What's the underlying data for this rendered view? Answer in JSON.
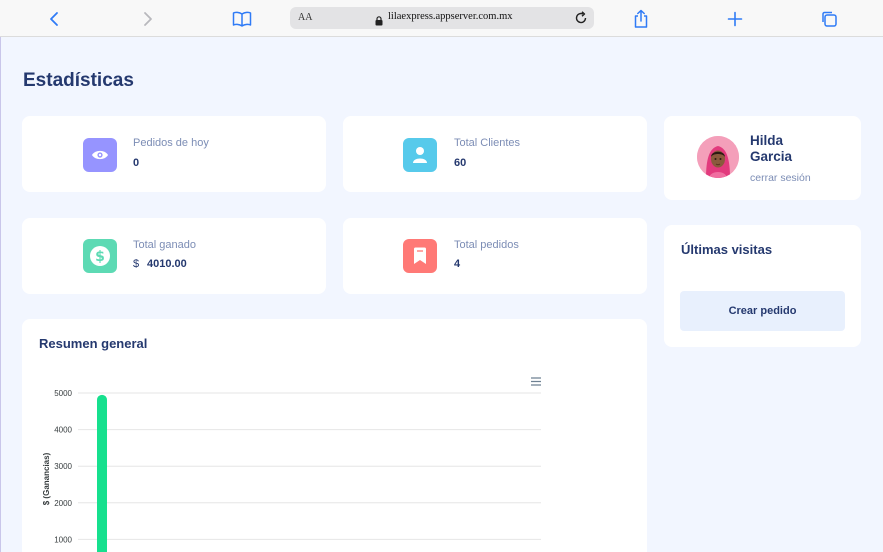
{
  "browser": {
    "text_size_label": "AA",
    "url": "lilaexpress.appserver.com.mx"
  },
  "page": {
    "title": "Estadísticas"
  },
  "stats": {
    "pedidos_hoy": {
      "label": "Pedidos de hoy",
      "value": "0",
      "color": "#9694ff"
    },
    "total_clientes": {
      "label": "Total Clientes",
      "value": "60",
      "color": "#57caeb"
    },
    "total_ganado": {
      "label": "Total ganado",
      "currency": "$",
      "value": "4010.00",
      "color": "#5ddab4"
    },
    "total_pedidos": {
      "label": "Total pedidos",
      "value": "4",
      "color": "#ff7976"
    }
  },
  "profile": {
    "name": "Hilda Garcia",
    "logout": "cerrar sesión"
  },
  "visits": {
    "title": "Últimas visitas",
    "create_order": "Crear pedido"
  },
  "summary": {
    "title": "Resumen general"
  },
  "chart_data": {
    "type": "bar",
    "ylabel": "$ (Ganancias)",
    "ylim": [
      0,
      5000
    ],
    "yticks": [
      1000,
      2000,
      3000,
      4000,
      5000
    ],
    "series": [
      {
        "color": "#16e08e",
        "values": [
          4950
        ]
      }
    ],
    "grid": true
  }
}
